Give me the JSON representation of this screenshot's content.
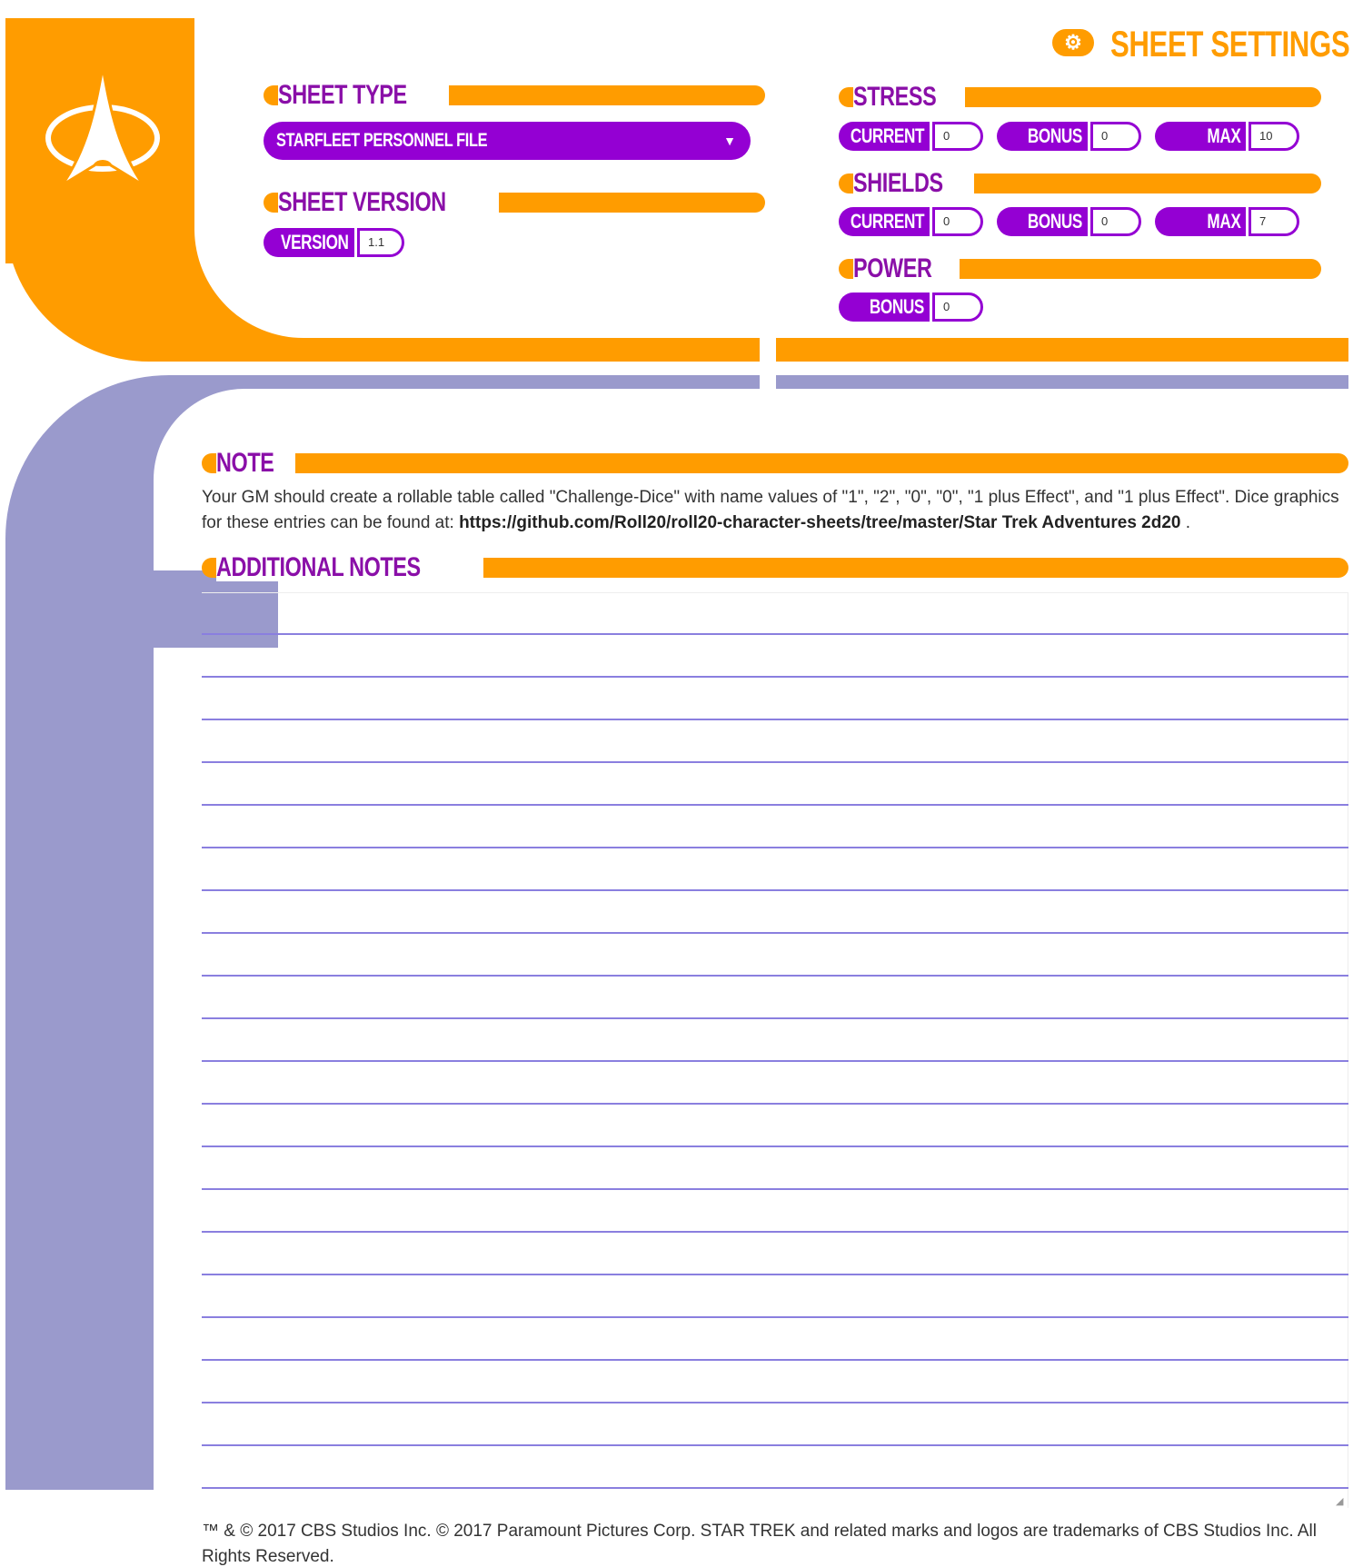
{
  "header": {
    "settings_label": "SHEET SETTINGS",
    "settings_icon": "⚙"
  },
  "sheet_type": {
    "title": "SHEET TYPE",
    "selected": "STARFLEET PERSONNEL FILE"
  },
  "sheet_version": {
    "title": "SHEET VERSION",
    "label": "VERSION",
    "value": "1.1"
  },
  "stress": {
    "title": "STRESS",
    "current_label": "CURRENT",
    "current": "0",
    "bonus_label": "BONUS",
    "bonus": "0",
    "max_label": "MAX",
    "max": "10"
  },
  "shields": {
    "title": "SHIELDS",
    "current_label": "CURRENT",
    "current": "0",
    "bonus_label": "BONUS",
    "bonus": "0",
    "max_label": "MAX",
    "max": "7"
  },
  "power": {
    "title": "POWER",
    "bonus_label": "BONUS",
    "bonus": "0"
  },
  "note": {
    "title": "NOTE",
    "text_before": "Your GM should create a rollable table called \"Challenge-Dice\" with name values of \"1\", \"2\", \"0\", \"0\", \"1 plus Effect\", and \"1 plus Effect\". Dice graphics for these entries can be found at: ",
    "link": "https://github.com/Roll20/roll20-character-sheets/tree/master/Star Trek Adventures 2d20",
    "text_after": " ."
  },
  "additional_notes": {
    "title": "ADDITIONAL NOTES",
    "value": ""
  },
  "footer": {
    "text": "™ & © 2017 CBS Studios Inc. © 2017 Paramount Pictures Corp. STAR TREK and related marks and logos are trademarks of CBS Studios Inc. All Rights Reserved."
  },
  "colors": {
    "orange": "#ff9c00",
    "purple": "#9400d3",
    "title_purple": "#8a0fa8",
    "lavender": "#9a9acc"
  }
}
